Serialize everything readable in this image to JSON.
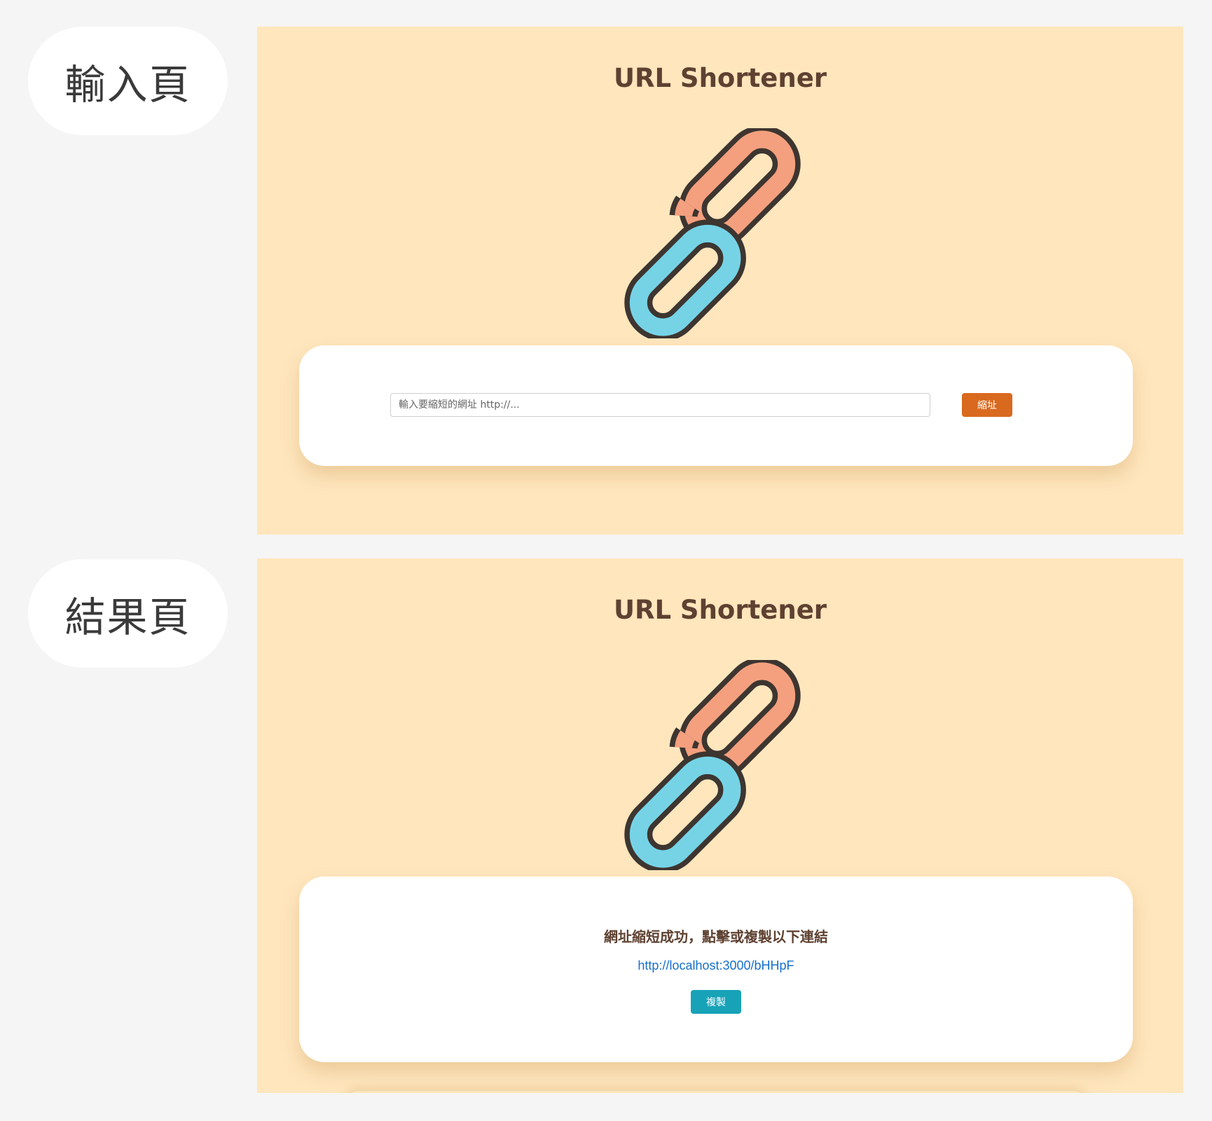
{
  "labels": {
    "input_page": "輸入頁",
    "result_page": "結果頁"
  },
  "input_page": {
    "title": "URL Shortener",
    "logo_icon": "chain-link-icon",
    "input_placeholder": "輸入要縮短的網址 http://...",
    "input_value": "",
    "submit_label": "縮址"
  },
  "result_page": {
    "title": "URL Shortener",
    "logo_icon": "chain-link-icon",
    "success_message": "網址縮短成功，點擊或複製以下連結",
    "short_url": "http://localhost:3000/bHHpF",
    "copy_label": "複製"
  },
  "colors": {
    "page_background": "#f5f5f5",
    "panel_background": "#ffe6bd",
    "title_text": "#5e4131",
    "submit_button": "#d9691e",
    "copy_button": "#17a2b8",
    "link_text": "#1670c9",
    "chain_orange": "#f4a07e",
    "chain_blue": "#76d3e6",
    "chain_outline": "#3d3530"
  }
}
